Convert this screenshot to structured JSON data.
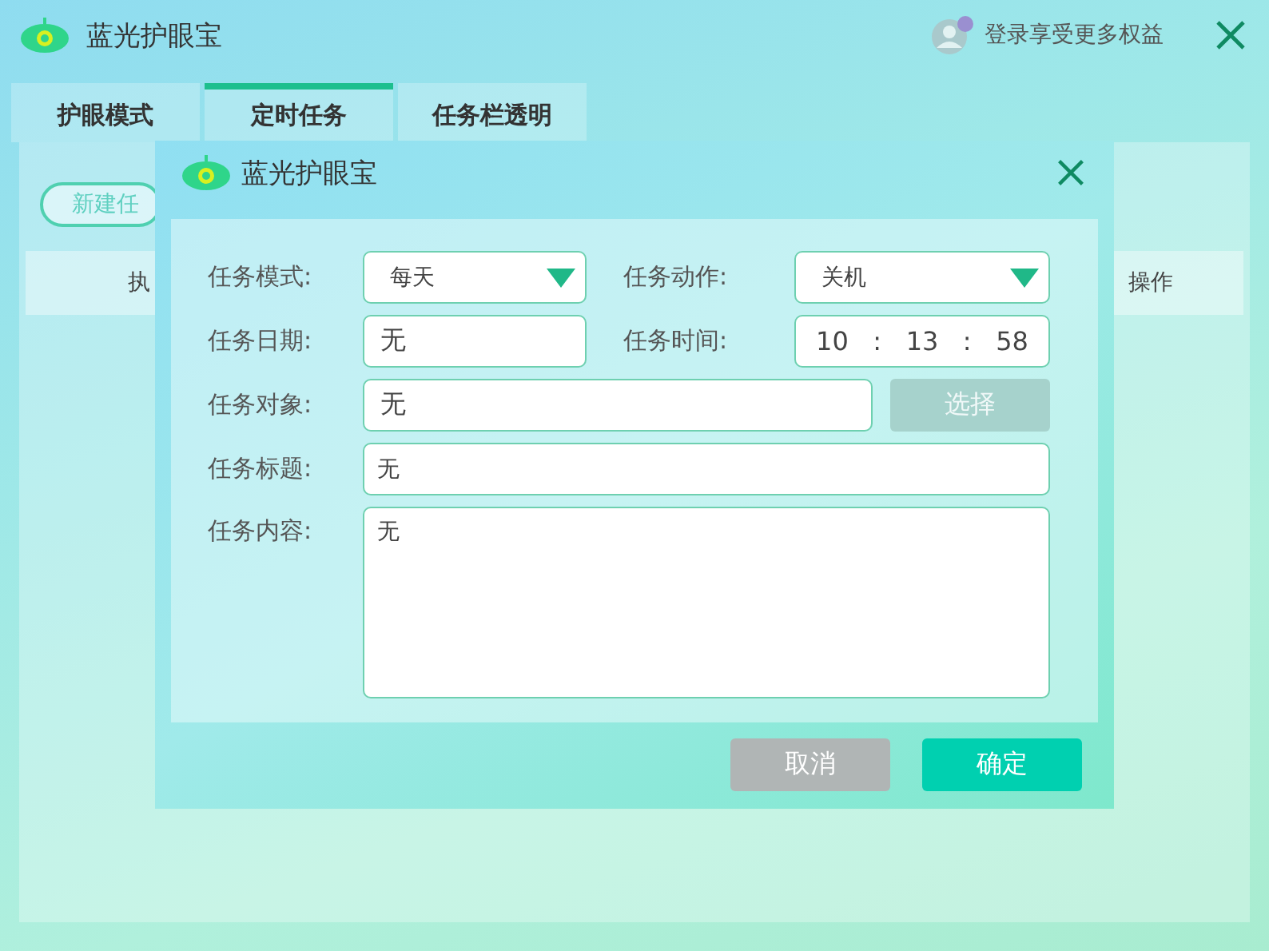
{
  "window": {
    "title": "蓝光护眼宝",
    "login": "登录享受更多权益"
  },
  "tabs": [
    {
      "label": "护眼模式",
      "selected": false
    },
    {
      "label": "定时任务",
      "selected": true
    },
    {
      "label": "任务栏透明",
      "selected": false
    }
  ],
  "new_task_button": "新建任",
  "table": {
    "columns": [
      "执",
      "操作"
    ]
  },
  "dialog": {
    "title": "蓝光护眼宝",
    "mode": {
      "label": "任务模式:",
      "value": "每天"
    },
    "action": {
      "label": "任务动作:",
      "value": "关机"
    },
    "date": {
      "label": "任务日期:",
      "value": "无"
    },
    "time": {
      "label": "任务时间:",
      "hour": "10",
      "sep1": ":",
      "minute": "13",
      "sep2": ":",
      "second": "58"
    },
    "target": {
      "label": "任务对象:",
      "value": "无",
      "button": "选择",
      "button_disabled": true
    },
    "task_title": {
      "label": "任务标题:",
      "value": "无"
    },
    "content": {
      "label": "任务内容:",
      "value": "无"
    },
    "buttons": [
      {
        "label": "取消",
        "kind": "secondary"
      },
      {
        "label": "确定",
        "kind": "primary"
      }
    ]
  }
}
